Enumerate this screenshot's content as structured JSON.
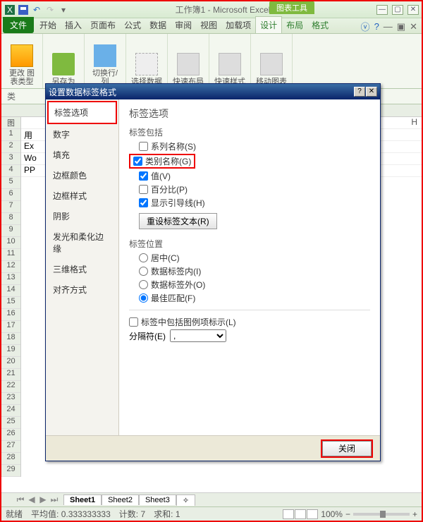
{
  "title": {
    "doc": "工作簿1 - Microsoft Excel",
    "chart_tools": "图表工具"
  },
  "tabs": {
    "file": "文件",
    "home": "开始",
    "insert": "插入",
    "layout": "页面布局",
    "formulas": "公式",
    "data": "数据",
    "review": "审阅",
    "view": "视图",
    "addins": "加载项",
    "design": "设计",
    "chlayout": "布局",
    "format": "格式"
  },
  "ribbon": {
    "change_type": "更改\n图表类型",
    "save_as": "另存为",
    "switch": "切换行/列",
    "select_data": "选择数据",
    "quick_layout": "快速布局",
    "quick_style": "快速样式",
    "move_chart": "移动图表"
  },
  "formula": {
    "namebox": "类"
  },
  "colH": "H",
  "rows": [
    "用",
    "Ex",
    "Wo",
    "PP"
  ],
  "dialog": {
    "title": "设置数据标签格式",
    "side": [
      "标签选项",
      "数字",
      "填充",
      "边框颜色",
      "边框样式",
      "阴影",
      "发光和柔化边缘",
      "三维格式",
      "对齐方式"
    ],
    "h": "标签选项",
    "grp1": "标签包括",
    "c_series": "系列名称(S)",
    "c_category": "类别名称(G)",
    "c_value": "值(V)",
    "c_percent": "百分比(P)",
    "c_leader": "显示引导线(H)",
    "reset": "重设标签文本(R)",
    "grp2": "标签位置",
    "r_center": "居中(C)",
    "r_inside": "数据标签内(I)",
    "r_outside": "数据标签外(O)",
    "r_bestfit": "最佳匹配(F)",
    "c_legend": "标签中包括图例项标示(L)",
    "sep_label": "分隔符(E)",
    "sep_value": ",",
    "close": "关闭"
  },
  "sheets": {
    "s1": "Sheet1",
    "s2": "Sheet2",
    "s3": "Sheet3"
  },
  "status": {
    "ready": "就绪",
    "avg_l": "平均值:",
    "avg": "0.333333333",
    "cnt_l": "计数:",
    "cnt": "7",
    "sum_l": "求和:",
    "sum": "1",
    "zoom": "100%"
  }
}
